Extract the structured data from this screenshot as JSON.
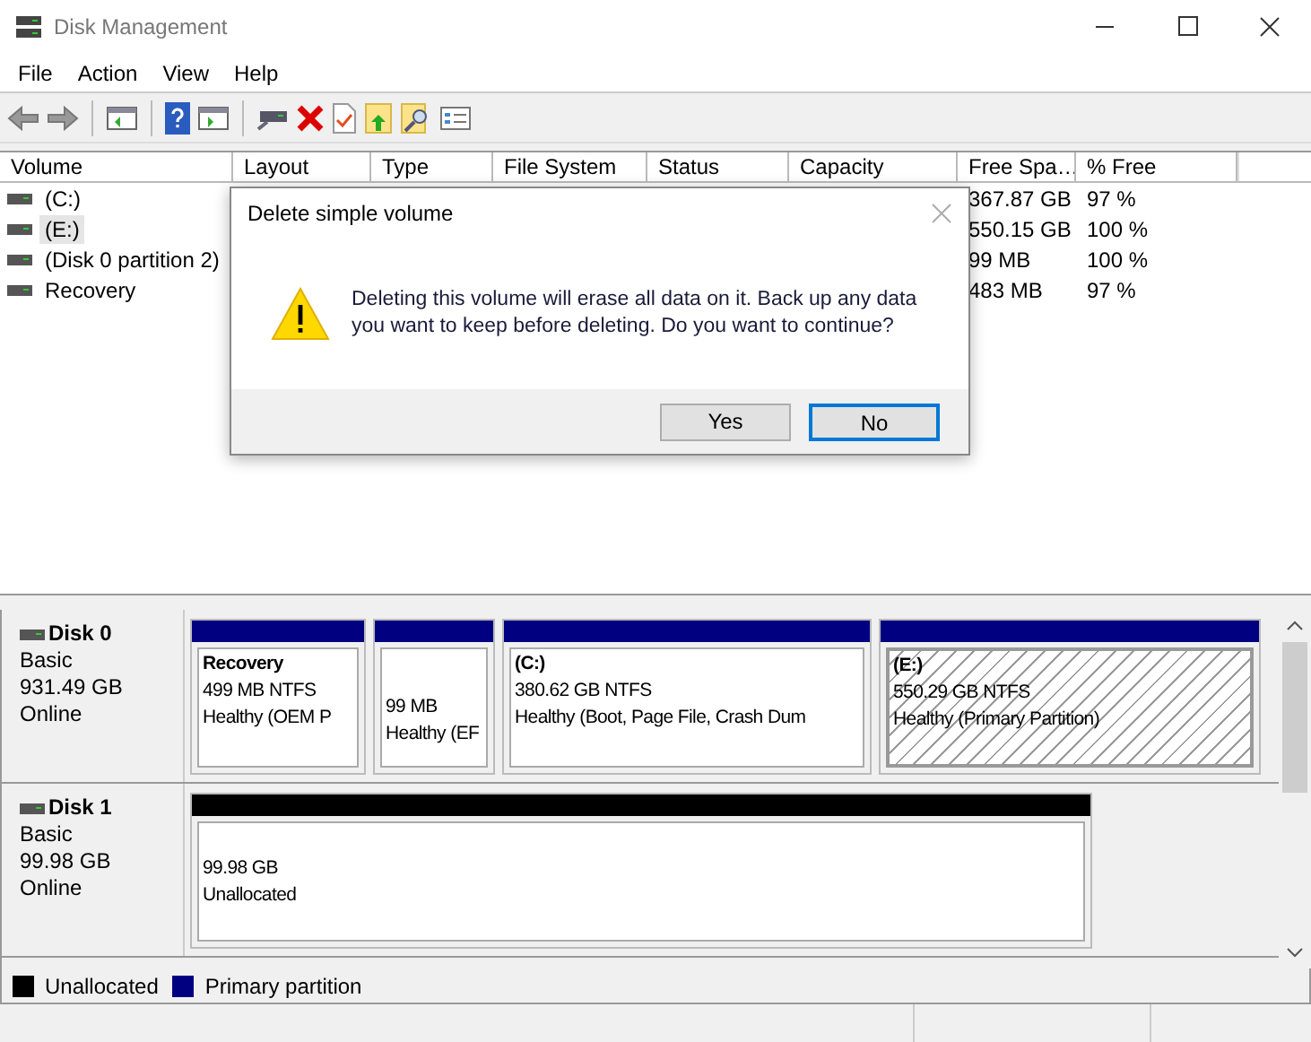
{
  "window": {
    "title": "Disk Management"
  },
  "menu": [
    {
      "label": "File"
    },
    {
      "label": "Action"
    },
    {
      "label": "View"
    },
    {
      "label": "Help"
    }
  ],
  "volume_list": {
    "columns": [
      "Volume",
      "Layout",
      "Type",
      "File System",
      "Status",
      "Capacity",
      "Free Spa…",
      "% Free"
    ],
    "rows": [
      {
        "volume": "(C:)",
        "free_space": "367.87 GB",
        "percent_free": "97 %",
        "selected": false
      },
      {
        "volume": "(E:)",
        "free_space": "550.15 GB",
        "percent_free": "100 %",
        "selected": true
      },
      {
        "volume": "(Disk 0 partition 2)",
        "free_space": "99 MB",
        "percent_free": "100 %",
        "selected": false
      },
      {
        "volume": "Recovery",
        "free_space": "483 MB",
        "percent_free": "97 %",
        "selected": false
      }
    ]
  },
  "dialog": {
    "title": "Delete simple volume",
    "message": "Deleting this volume will erase all data on it. Back up any data you want to keep before deleting. Do you want to continue?",
    "buttons": [
      {
        "label": "Yes",
        "focused": false
      },
      {
        "label": "No",
        "focused": true
      }
    ]
  },
  "disks": [
    {
      "name": "Disk 0",
      "type": "Basic",
      "size": "931.49 GB",
      "status": "Online",
      "partitions": [
        {
          "kind": "primary",
          "name": "Recovery",
          "size": "499 MB NTFS",
          "status": "Healthy (OEM P",
          "selected": false
        },
        {
          "kind": "primary",
          "size": "99 MB",
          "status": "Healthy (EF",
          "selected": false
        },
        {
          "kind": "primary",
          "name": "(C:)",
          "size": "380.62 GB NTFS",
          "status": "Healthy (Boot, Page File, Crash Dum",
          "selected": false
        },
        {
          "kind": "primary",
          "name": "(E:)",
          "size": "550.29 GB NTFS",
          "status": "Healthy (Primary Partition)",
          "selected": true
        }
      ]
    },
    {
      "name": "Disk 1",
      "type": "Basic",
      "size": "99.98 GB",
      "status": "Online",
      "partitions": [
        {
          "kind": "unallocated",
          "size": "99.98 GB",
          "status": "Unallocated",
          "selected": false
        }
      ]
    }
  ],
  "legend": [
    {
      "label": "Unallocated",
      "color": "#000000"
    },
    {
      "label": "Primary partition",
      "color": "#000080"
    }
  ]
}
